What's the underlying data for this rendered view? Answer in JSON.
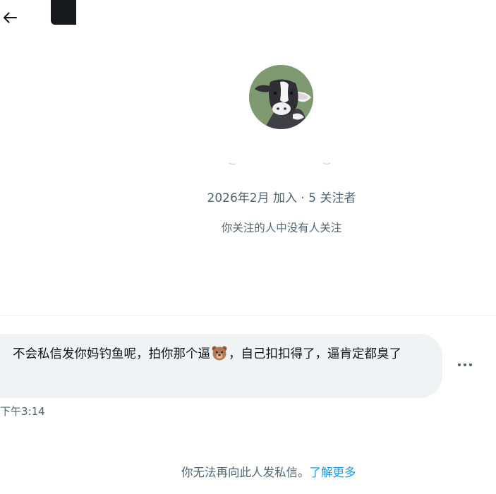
{
  "profile": {
    "joined": "2026年2月 加入",
    "separator": " · ",
    "followers_count": "5",
    "followers_label": " 关注者",
    "mutual_note": "你关注的人中没有人关注"
  },
  "message": {
    "text_before_icon": "不会私信发你妈钓鱼呢，拍你那个逼",
    "icon": "bear-face-icon",
    "text_after_icon": "，自己扣扣得了，逼肯定都臭了",
    "time": "下午3:14"
  },
  "footer": {
    "notice": "你无法再向此人发私信。",
    "link": "了解更多"
  },
  "colors": {
    "avatar_bg": "#7f9a70",
    "bubble_bg": "#eff3f4",
    "link": "#1d9bf0",
    "muted_text": "#536471"
  }
}
